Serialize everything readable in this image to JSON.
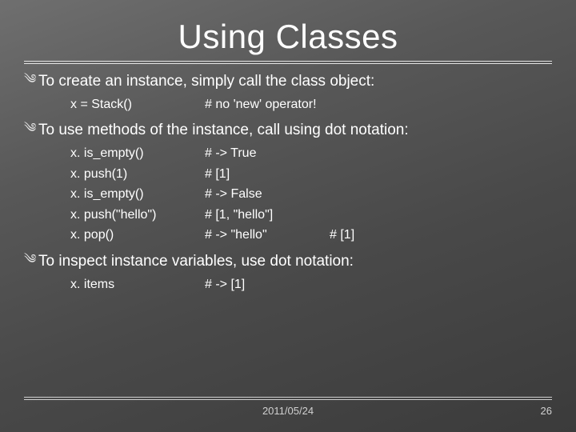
{
  "title": "Using Classes",
  "bullets": {
    "b1": "To create an instance, simply call the class object:",
    "b2": "To use methods of the instance, call using dot notation:",
    "b3": "To inspect instance variables, use dot notation:"
  },
  "code1": {
    "r0": {
      "left": "x = Stack()",
      "mid": "# no 'new' operator!"
    }
  },
  "code2": {
    "r0": {
      "left": "x. is_empty()",
      "mid": "# -> True"
    },
    "r1": {
      "left": "x. push(1)",
      "mid": "# [1]"
    },
    "r2": {
      "left": "x. is_empty()",
      "mid": "# -> False"
    },
    "r3": {
      "left": "x. push(\"hello\")",
      "mid": "# [1, \"hello\"]"
    },
    "r4": {
      "left": "x. pop()",
      "mid": "# -> \"hello\"",
      "right": "# [1]"
    }
  },
  "code3": {
    "r0": {
      "left": "x. items",
      "mid": "# -> [1]"
    }
  },
  "footer": {
    "date": "2011/05/24",
    "page": "26"
  },
  "glyph": {
    "bullet": "༄"
  }
}
